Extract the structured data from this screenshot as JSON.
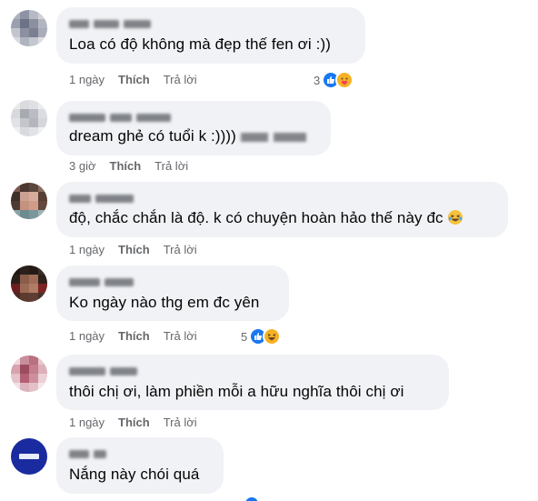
{
  "comments": [
    {
      "text": "Loa có độ không mà đẹp thế fen ơi :))",
      "time": "1 ngày",
      "like_label": "Thích",
      "reply_label": "Trả lời",
      "reaction_count": "3",
      "reactions": [
        "like-icon",
        "care-icon"
      ]
    },
    {
      "text": "dream ghẻ có tuổi k :))))",
      "time": "3 giờ",
      "like_label": "Thích",
      "reply_label": "Trả lời"
    },
    {
      "text": "độ, chắc chắn là độ. k có chuyện hoàn hảo thế này đc",
      "time": "1 ngày",
      "like_label": "Thích",
      "reply_label": "Trả lời",
      "inline_emoji": "laughing-tears-icon"
    },
    {
      "text": "Ko ngày nào thg em đc yên",
      "time": "1 ngày",
      "like_label": "Thích",
      "reply_label": "Trả lời",
      "reaction_count": "5",
      "reactions": [
        "like-icon",
        "haha-icon"
      ]
    },
    {
      "text": "thôi chị ơi, làm phiền mỗi a hữu nghĩa thôi chị ơi",
      "time": "1 ngày",
      "like_label": "Thích",
      "reply_label": "Trả lời"
    },
    {
      "text": "Nắng này chói quá"
    }
  ],
  "colors": {
    "bubble": "#f0f2f5",
    "meta_text": "#65676b",
    "like_blue": "#1877f2",
    "emoji_yellow": "#f7b125"
  }
}
